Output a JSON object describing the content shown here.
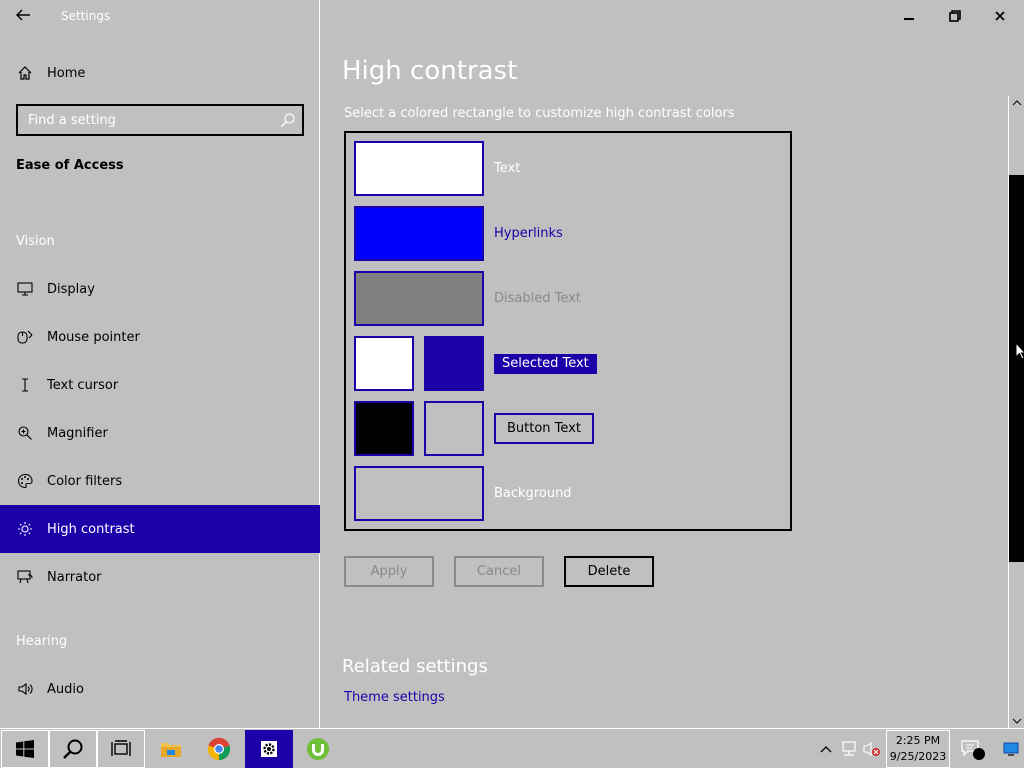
{
  "window": {
    "app_title": "Settings",
    "controls": {
      "minimize": "minimize",
      "restore": "restore",
      "close": "close"
    }
  },
  "sidebar": {
    "home_label": "Home",
    "search_placeholder": "Find a setting",
    "group_title": "Ease of Access",
    "sections": [
      {
        "heading": "Vision",
        "items": [
          {
            "label": "Display",
            "icon": "monitor-icon"
          },
          {
            "label": "Mouse pointer",
            "icon": "mouse-pointer-icon"
          },
          {
            "label": "Text cursor",
            "icon": "text-cursor-icon"
          },
          {
            "label": "Magnifier",
            "icon": "magnifier-icon"
          },
          {
            "label": "Color filters",
            "icon": "palette-icon"
          },
          {
            "label": "High contrast",
            "icon": "sun-icon",
            "active": true
          },
          {
            "label": "Narrator",
            "icon": "narrator-icon"
          }
        ]
      },
      {
        "heading": "Hearing",
        "items": [
          {
            "label": "Audio",
            "icon": "speaker-icon"
          }
        ]
      }
    ]
  },
  "main": {
    "title": "High contrast",
    "instructions": "Select a colored rectangle to customize high contrast colors",
    "swatches": {
      "text": {
        "label": "Text",
        "color": "#ffffff"
      },
      "hyperlinks": {
        "label": "Hyperlinks",
        "color": "#0000ff",
        "label_color": "#1c00a8"
      },
      "disabled_text": {
        "label": "Disabled Text",
        "color": "#808080",
        "label_color": "#8a8a8a"
      },
      "selected_text": {
        "label": "Selected Text",
        "colors": [
          "#ffffff",
          "#1c00a8"
        ]
      },
      "button_text": {
        "label": "Button Text",
        "colors": [
          "#000000",
          "#c0c0c0"
        ]
      },
      "background": {
        "label": "Background",
        "color": "#c0c0c0"
      }
    },
    "buttons": {
      "apply": "Apply",
      "cancel": "Cancel",
      "delete": "Delete"
    },
    "related": {
      "title": "Related settings",
      "links": [
        "Theme settings"
      ]
    }
  },
  "scrollbar": {
    "position_fraction": 0.3
  },
  "taskbar": {
    "pinned": [
      {
        "name": "start-button",
        "icon": "windows-logo-icon"
      },
      {
        "name": "search-button",
        "icon": "search-icon"
      },
      {
        "name": "task-view-button",
        "icon": "task-view-icon"
      },
      {
        "name": "file-explorer-button",
        "icon": "folder-icon"
      },
      {
        "name": "chrome-button",
        "icon": "chrome-icon"
      },
      {
        "name": "settings-button",
        "icon": "gear-icon",
        "active": true
      },
      {
        "name": "utorrent-button",
        "icon": "utorrent-icon"
      }
    ],
    "clock": {
      "time": "2:25 PM",
      "date": "9/25/2023"
    }
  },
  "colors": {
    "background": "#c0c0c0",
    "accent": "#1c00a8",
    "text_light": "#ffffff",
    "disabled": "#8a8a8a"
  }
}
